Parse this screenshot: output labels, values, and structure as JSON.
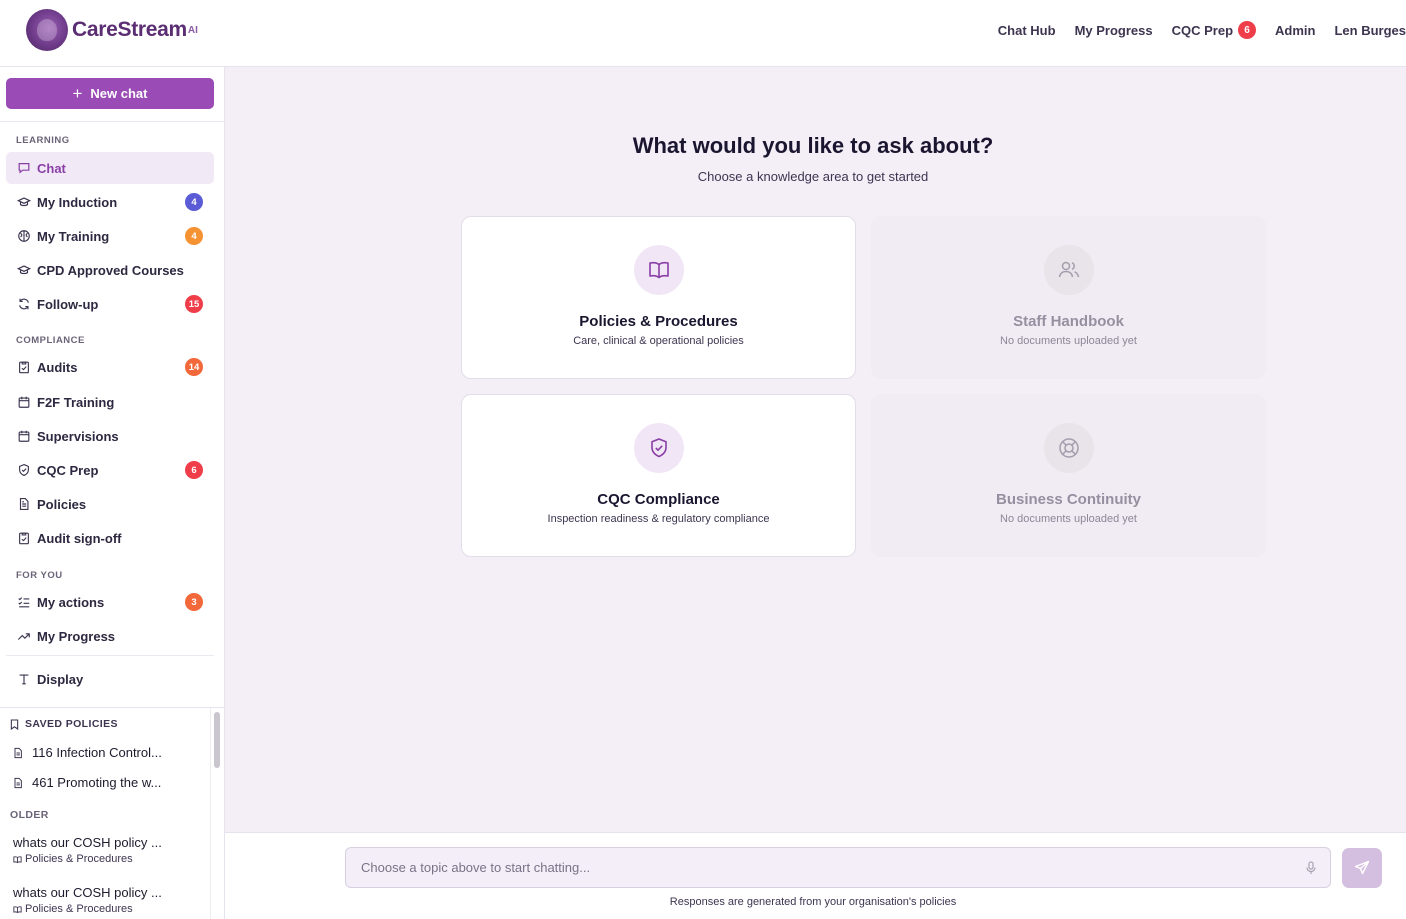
{
  "brand": {
    "name": "CareStream",
    "suffix": "AI"
  },
  "topnav": {
    "items": [
      "Chat Hub",
      "My Progress",
      "CQC Prep",
      "Admin",
      "Len Burges"
    ],
    "cqc_badge": "6"
  },
  "sidebar": {
    "new_chat": "New chat",
    "sections": {
      "learning": "LEARNING",
      "compliance": "COMPLIANCE",
      "for_you": "FOR YOU"
    },
    "items": [
      {
        "label": "Chat",
        "icon": "chat-icon"
      },
      {
        "label": "My Induction",
        "badge": "4",
        "badge_color": "#5b5bd6",
        "icon": "graduation-cap-icon"
      },
      {
        "label": "My Training",
        "badge": "4",
        "badge_color": "#f59332",
        "icon": "brain-icon"
      },
      {
        "label": "CPD Approved Courses",
        "icon": "graduation-cap-icon"
      },
      {
        "label": "Follow-up",
        "badge": "15",
        "badge_color": "#ef3e4a",
        "icon": "refresh-icon"
      },
      {
        "label": "Audits",
        "badge": "14",
        "badge_color": "#f2683a",
        "icon": "clipboard-check-icon"
      },
      {
        "label": "F2F Training",
        "icon": "calendar-icon"
      },
      {
        "label": "Supervisions",
        "icon": "calendar-icon"
      },
      {
        "label": "CQC Prep",
        "badge": "6",
        "badge_color": "#ef3e4a",
        "icon": "shield-check-icon"
      },
      {
        "label": "Policies",
        "icon": "document-icon"
      },
      {
        "label": "Audit sign-off",
        "icon": "clipboard-check-icon"
      },
      {
        "label": "My actions",
        "badge": "3",
        "badge_color": "#f2683a",
        "icon": "checklist-icon"
      },
      {
        "label": "My Progress",
        "icon": "trending-up-icon"
      },
      {
        "label": "Display",
        "icon": "type-icon"
      }
    ],
    "saved": {
      "title": "SAVED POLICIES",
      "docs": [
        "116 Infection Control...",
        "461 Promoting the w..."
      ],
      "older_label": "OLDER",
      "older": [
        {
          "question": "whats our COSH policy ...",
          "tag": "Policies & Procedures"
        },
        {
          "question": "whats our COSH policy ...",
          "tag": "Policies & Procedures"
        }
      ]
    }
  },
  "main": {
    "title": "What would you like to ask about?",
    "subtitle": "Choose a knowledge area to get started",
    "cards": [
      {
        "title": "Policies & Procedures",
        "desc": "Care, clinical & operational policies",
        "icon": "book-open-icon"
      },
      {
        "title": "Staff Handbook",
        "desc": "No documents uploaded yet",
        "icon": "users-icon"
      },
      {
        "title": "CQC Compliance",
        "desc": "Inspection readiness & regulatory compliance",
        "icon": "shield-check-icon"
      },
      {
        "title": "Business Continuity",
        "desc": "No documents uploaded yet",
        "icon": "life-buoy-icon"
      }
    ]
  },
  "chat": {
    "placeholder": "Choose a topic above to start chatting...",
    "disclaimer": "Responses are generated from your organisation's policies"
  },
  "colors": {
    "accent": "#9a4bb5",
    "main_bg": "#f4eef7"
  }
}
